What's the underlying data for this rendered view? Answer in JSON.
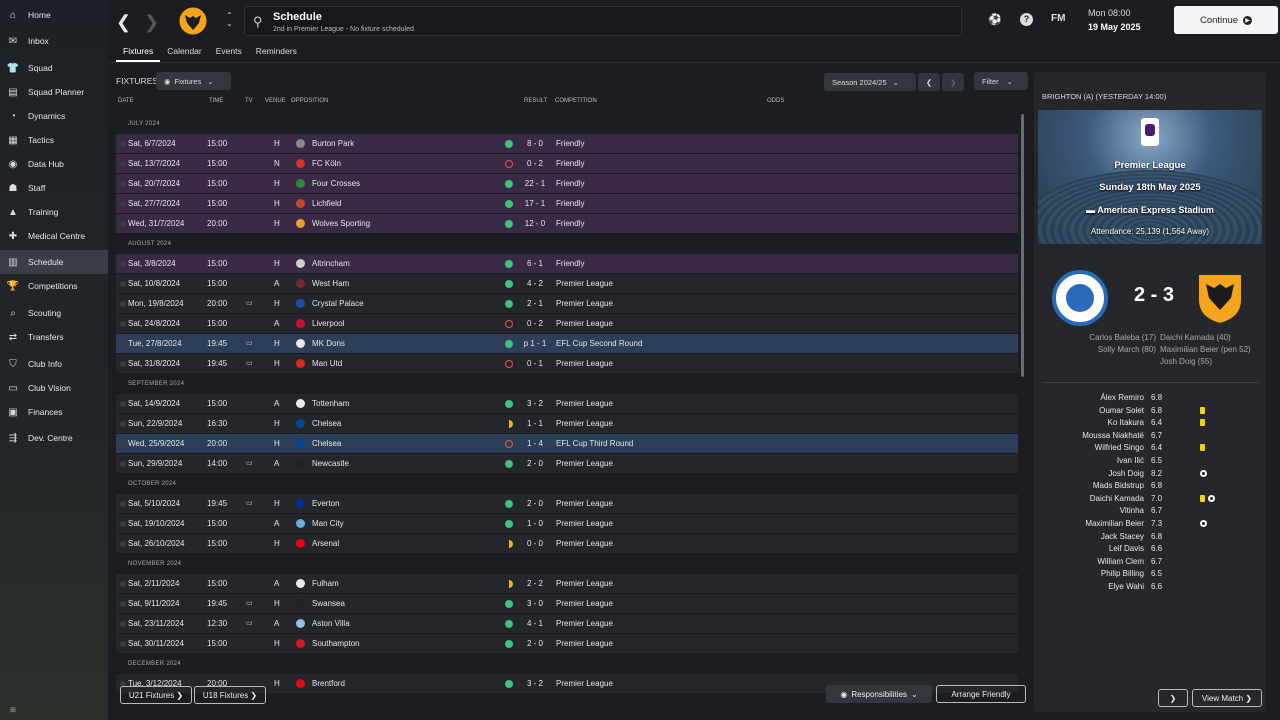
{
  "sidebar": {
    "items": [
      {
        "label": "Home",
        "icon": "⌂"
      },
      {
        "label": "Inbox",
        "icon": "✉"
      },
      {
        "label": "Squad",
        "icon": "👕"
      },
      {
        "label": "Squad Planner",
        "icon": "▤"
      },
      {
        "label": "Dynamics",
        "icon": "◔"
      },
      {
        "label": "Tactics",
        "icon": "▦"
      },
      {
        "label": "Data Hub",
        "icon": "◉"
      },
      {
        "label": "Staff",
        "icon": "☗"
      },
      {
        "label": "Training",
        "icon": "▲"
      },
      {
        "label": "Medical Centre",
        "icon": "✚"
      },
      {
        "label": "Schedule",
        "icon": "▥"
      },
      {
        "label": "Competitions",
        "icon": "🏆"
      },
      {
        "label": "Scouting",
        "icon": "⌕"
      },
      {
        "label": "Transfers",
        "icon": "⇄"
      },
      {
        "label": "Club Info",
        "icon": "⛉"
      },
      {
        "label": "Club Vision",
        "icon": "▭"
      },
      {
        "label": "Finances",
        "icon": "▣"
      },
      {
        "label": "Dev. Centre",
        "icon": "⇶"
      }
    ],
    "active_index": 10,
    "bottom_badge": "⊞"
  },
  "topbar": {
    "title": "Schedule",
    "subtitle": "2nd in Premier League - No fixture scheduled.",
    "date_time": "Mon 08:00",
    "date_day": "19 May 2025",
    "continue_label": "Continue",
    "fm_label": "FM",
    "help_label": "?"
  },
  "tabs": [
    "Fixtures",
    "Calendar",
    "Events",
    "Reminders"
  ],
  "fixtures_panel": {
    "label": "FIXTURES",
    "filter_dropdown": "Fixtures",
    "season": "Season 2024/25",
    "filter_label": "Filter",
    "columns": {
      "date": "DATE",
      "time": "TIME",
      "tv": "TV",
      "venue": "VENUE",
      "opposition": "OPPOSITION",
      "result": "RESULT",
      "competition": "COMPETITION",
      "odds": "ODDS"
    },
    "months": [
      {
        "name": "JULY 2024",
        "rows": [
          {
            "date": "Sat, 6/7/2024",
            "time": "15:00",
            "tv": "",
            "venue": "H",
            "opp": "Burton Park",
            "crest": "#8a8a8a",
            "result": "win",
            "score": "8 - 0",
            "comp": "Friendly",
            "kind": "friendly"
          },
          {
            "date": "Sat, 13/7/2024",
            "time": "15:00",
            "tv": "",
            "venue": "N",
            "opp": "FC Köln",
            "crest": "#d9302b",
            "result": "loss",
            "score": "0 - 2",
            "comp": "Friendly",
            "kind": "friendly"
          },
          {
            "date": "Sat, 20/7/2024",
            "time": "15:00",
            "tv": "",
            "venue": "H",
            "opp": "Four Crosses",
            "crest": "#2d8a3a",
            "result": "win",
            "score": "22 - 1",
            "comp": "Friendly",
            "kind": "friendly"
          },
          {
            "date": "Sat, 27/7/2024",
            "time": "15:00",
            "tv": "",
            "venue": "H",
            "opp": "Lichfield",
            "crest": "#c94a2a",
            "result": "win",
            "score": "17 - 1",
            "comp": "Friendly",
            "kind": "friendly"
          },
          {
            "date": "Wed, 31/7/2024",
            "time": "20:00",
            "tv": "",
            "venue": "H",
            "opp": "Wolves Sporting",
            "crest": "#f0a030",
            "result": "win",
            "score": "12 - 0",
            "comp": "Friendly",
            "kind": "friendly"
          }
        ]
      },
      {
        "name": "AUGUST 2024",
        "rows": [
          {
            "date": "Sat, 3/8/2024",
            "time": "15:00",
            "tv": "",
            "venue": "H",
            "opp": "Altrincham",
            "crest": "#cfcfcf",
            "result": "win",
            "score": "6 - 1",
            "comp": "Friendly",
            "kind": "friendly"
          },
          {
            "date": "Sat, 10/8/2024",
            "time": "15:00",
            "tv": "",
            "venue": "A",
            "opp": "West Ham",
            "crest": "#7a2634",
            "result": "win",
            "score": "4 - 2",
            "comp": "Premier League",
            "kind": "normal"
          },
          {
            "date": "Mon, 19/8/2024",
            "time": "20:00",
            "tv": "▭",
            "venue": "H",
            "opp": "Crystal Palace",
            "crest": "#1b4fa0",
            "result": "win",
            "score": "2 - 1",
            "comp": "Premier League",
            "kind": "normal"
          },
          {
            "date": "Sat, 24/8/2024",
            "time": "15:00",
            "tv": "",
            "venue": "A",
            "opp": "Liverpool",
            "crest": "#c8102e",
            "result": "loss",
            "score": "0 - 2",
            "comp": "Premier League",
            "kind": "normal"
          },
          {
            "date": "Tue, 27/8/2024",
            "time": "19:45",
            "tv": "▭",
            "venue": "H",
            "opp": "MK Dons",
            "crest": "#e8e8e8",
            "result": "win",
            "score": "p 1 - 1",
            "comp": "EFL Cup Second Round",
            "kind": "selected"
          },
          {
            "date": "Sat, 31/8/2024",
            "time": "19:45",
            "tv": "▭",
            "venue": "H",
            "opp": "Man Utd",
            "crest": "#da291c",
            "result": "loss",
            "score": "0 - 1",
            "comp": "Premier League",
            "kind": "normal"
          }
        ]
      },
      {
        "name": "SEPTEMBER 2024",
        "rows": [
          {
            "date": "Sat, 14/9/2024",
            "time": "15:00",
            "tv": "",
            "venue": "A",
            "opp": "Tottenham",
            "crest": "#e8e8e8",
            "result": "win",
            "score": "3 - 2",
            "comp": "Premier League",
            "kind": "normal"
          },
          {
            "date": "Sun, 22/9/2024",
            "time": "16:30",
            "tv": "",
            "venue": "H",
            "opp": "Chelsea",
            "crest": "#034694",
            "result": "draw",
            "score": "1 - 1",
            "comp": "Premier League",
            "kind": "normal"
          },
          {
            "date": "Wed, 25/9/2024",
            "time": "20:00",
            "tv": "",
            "venue": "H",
            "opp": "Chelsea",
            "crest": "#034694",
            "result": "loss",
            "score": "1 - 4",
            "comp": "EFL Cup Third Round",
            "kind": "selected"
          },
          {
            "date": "Sun, 29/9/2024",
            "time": "14:00",
            "tv": "▭",
            "venue": "A",
            "opp": "Newcastle",
            "crest": "#222222",
            "result": "win",
            "score": "2 - 0",
            "comp": "Premier League",
            "kind": "normal"
          }
        ]
      },
      {
        "name": "OCTOBER 2024",
        "rows": [
          {
            "date": "Sat, 5/10/2024",
            "time": "19:45",
            "tv": "▭",
            "venue": "H",
            "opp": "Everton",
            "crest": "#003399",
            "result": "win",
            "score": "2 - 0",
            "comp": "Premier League",
            "kind": "normal"
          },
          {
            "date": "Sat, 19/10/2024",
            "time": "15:00",
            "tv": "",
            "venue": "A",
            "opp": "Man City",
            "crest": "#6cabdd",
            "result": "win",
            "score": "1 - 0",
            "comp": "Premier League",
            "kind": "normal"
          },
          {
            "date": "Sat, 26/10/2024",
            "time": "15:00",
            "tv": "",
            "venue": "H",
            "opp": "Arsenal",
            "crest": "#ef0107",
            "result": "draw",
            "score": "0 - 0",
            "comp": "Premier League",
            "kind": "normal"
          }
        ]
      },
      {
        "name": "NOVEMBER 2024",
        "rows": [
          {
            "date": "Sat, 2/11/2024",
            "time": "15:00",
            "tv": "",
            "venue": "A",
            "opp": "Fulham",
            "crest": "#e8e8e8",
            "result": "draw",
            "score": "2 - 2",
            "comp": "Premier League",
            "kind": "normal"
          },
          {
            "date": "Sat, 9/11/2024",
            "time": "19:45",
            "tv": "▭",
            "venue": "H",
            "opp": "Swansea",
            "crest": "#222222",
            "result": "win",
            "score": "3 - 0",
            "comp": "Premier League",
            "kind": "normal"
          },
          {
            "date": "Sat, 23/11/2024",
            "time": "12:30",
            "tv": "▭",
            "venue": "A",
            "opp": "Aston Villa",
            "crest": "#95bfe5",
            "result": "win",
            "score": "4 - 1",
            "comp": "Premier League",
            "kind": "normal"
          },
          {
            "date": "Sat, 30/11/2024",
            "time": "15:00",
            "tv": "",
            "venue": "H",
            "opp": "Southampton",
            "crest": "#d71920",
            "result": "win",
            "score": "2 - 0",
            "comp": "Premier League",
            "kind": "normal"
          }
        ]
      },
      {
        "name": "DECEMBER 2024",
        "rows": [
          {
            "date": "Tue, 3/12/2024",
            "time": "20:00",
            "tv": "",
            "venue": "H",
            "opp": "Brentford",
            "crest": "#e30613",
            "result": "win",
            "score": "3 - 2",
            "comp": "Premier League",
            "kind": "normal"
          }
        ]
      }
    ],
    "bottom_buttons": {
      "u21": "U21 Fixtures",
      "u18": "U18 Fixtures",
      "responsibilities": "Responsibilities",
      "arrange": "Arrange Friendly"
    }
  },
  "match_panel": {
    "header": "BRIGHTON (A) (YESTERDAY 14:00)",
    "competition": "Premier League",
    "date": "Sunday 18th May 2025",
    "venue": "American Express Stadium",
    "attendance": "Attendance: 25,139 (1,564 Away)",
    "score": "2 - 3",
    "home_scorers": [
      "Carlos Baleba (17)",
      "Solly March (80)"
    ],
    "away_scorers": [
      "Daichi Kamada (40)",
      "Maximilian Beier (pen 52)",
      "Josh Doig (55)"
    ],
    "players": [
      {
        "name": "Álex Remiro",
        "rating": "6.8",
        "yc": false,
        "goal": false
      },
      {
        "name": "Oumar Solet",
        "rating": "6.8",
        "yc": true,
        "goal": false
      },
      {
        "name": "Ko Itakura",
        "rating": "6.4",
        "yc": true,
        "goal": false
      },
      {
        "name": "Moussa Niakhaté",
        "rating": "6.7",
        "yc": false,
        "goal": false
      },
      {
        "name": "Wilfried Singo",
        "rating": "6.4",
        "yc": true,
        "goal": false
      },
      {
        "name": "Ivan Ilić",
        "rating": "6.5",
        "yc": false,
        "goal": false
      },
      {
        "name": "Josh Doig",
        "rating": "8.2",
        "yc": false,
        "goal": true
      },
      {
        "name": "Mads Bidstrup",
        "rating": "6.8",
        "yc": false,
        "goal": false
      },
      {
        "name": "Daichi Kamada",
        "rating": "7.0",
        "yc": true,
        "goal": true
      },
      {
        "name": "Vitinha",
        "rating": "6.7",
        "yc": false,
        "goal": false
      },
      {
        "name": "Maximilian Beier",
        "rating": "7.3",
        "yc": false,
        "goal": true
      },
      {
        "name": "Jack Stacey",
        "rating": "6.8",
        "yc": false,
        "goal": false
      },
      {
        "name": "Leif Davis",
        "rating": "6.6",
        "yc": false,
        "goal": false
      },
      {
        "name": "William Clem",
        "rating": "6.7",
        "yc": false,
        "goal": false
      },
      {
        "name": "Philip Billing",
        "rating": "6.5",
        "yc": false,
        "goal": false
      },
      {
        "name": "Elye Wahi",
        "rating": "6.6",
        "yc": false,
        "goal": false
      }
    ],
    "view_match_label": "View Match"
  }
}
